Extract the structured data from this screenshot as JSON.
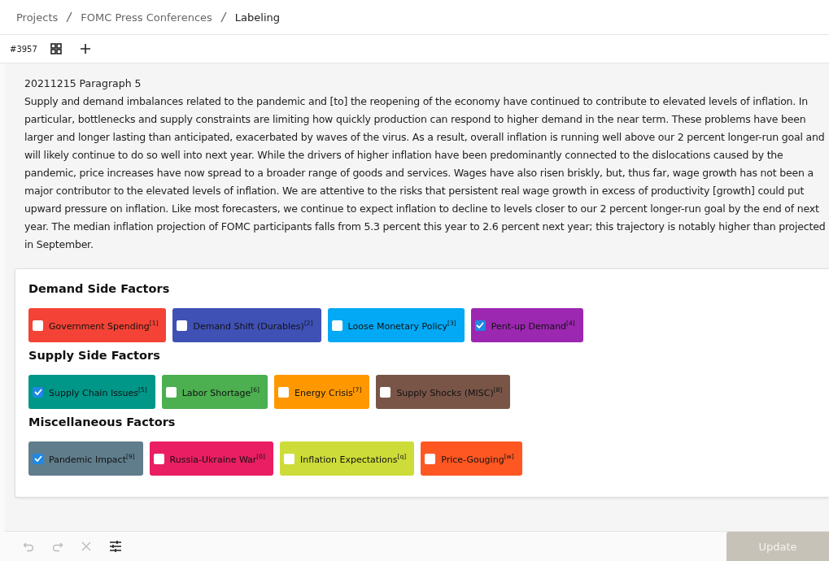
{
  "breadcrumbs": [
    {
      "label": "Projects",
      "current": false
    },
    {
      "label": "FOMC Press Conferences",
      "current": false
    },
    {
      "label": "Labeling",
      "current": true
    }
  ],
  "task_id": "#3957",
  "document": {
    "title": "20211215 Paragraph 5",
    "text": "Supply and demand imbalances related to the pandemic and [to] the reopening of the economy have continued to contribute to elevated levels of inflation. In particular, bottlenecks and supply constraints are limiting how quickly production can respond to higher demand in the near term. These problems have been larger and longer lasting than anticipated, exacerbated by waves of the virus. As a result, overall inflation is running well above our 2 percent longer-run goal and will likely continue to do so well into next year. While the drivers of higher inflation have been predominantly connected to the dislocations caused by the pandemic, price increases have now spread to a broader range of goods and services. Wages have also risen briskly, but, thus far, wage growth has not been a major contributor to the elevated levels of inflation. We are attentive to the risks that persistent real wage growth in excess of productivity [growth] could put upward pressure on inflation. Like most forecasters, we continue to expect inflation to decline to levels closer to our 2 percent longer-run goal by the end of next year. The median inflation projection of FOMC participants falls from 5.3 percent this year to 2.6 percent next year; this trajectory is notably higher than projected in September."
  },
  "groups": [
    {
      "title": "Demand Side Factors",
      "choices": [
        {
          "label": "Government Spending",
          "hotkey": "[1]",
          "color": "#f44336",
          "checked": false
        },
        {
          "label": "Demand Shift (Durables)",
          "hotkey": "[2]",
          "color": "#3f51b5",
          "checked": false
        },
        {
          "label": "Loose Monetary Policy",
          "hotkey": "[3]",
          "color": "#03a9f4",
          "checked": false
        },
        {
          "label": "Pent-up Demand",
          "hotkey": "[4]",
          "color": "#9c27b0",
          "checked": true
        }
      ]
    },
    {
      "title": "Supply Side Factors",
      "choices": [
        {
          "label": "Supply Chain Issues",
          "hotkey": "[5]",
          "color": "#009688",
          "checked": true
        },
        {
          "label": "Labor Shortage",
          "hotkey": "[6]",
          "color": "#4caf50",
          "checked": false
        },
        {
          "label": "Energy Crisis",
          "hotkey": "[7]",
          "color": "#ff9800",
          "checked": false
        },
        {
          "label": "Supply Shocks (MISC)",
          "hotkey": "[8]",
          "color": "#795548",
          "checked": false
        }
      ]
    },
    {
      "title": "Miscellaneous Factors",
      "choices": [
        {
          "label": "Pandemic Impact",
          "hotkey": "[9]",
          "color": "#607d8b",
          "checked": true
        },
        {
          "label": "Russia-Ukraine War",
          "hotkey": "[0]",
          "color": "#e91e63",
          "checked": false
        },
        {
          "label": "Inflation Expectations",
          "hotkey": "[q]",
          "color": "#cddc39",
          "checked": false
        },
        {
          "label": "Price-Gouging",
          "hotkey": "[w]",
          "color": "#ff5722",
          "checked": false
        }
      ]
    }
  ],
  "toolbar": {
    "undo_disabled": true,
    "redo_disabled": true,
    "clear_disabled": true
  },
  "update_button": {
    "label": "Update",
    "disabled": true
  }
}
